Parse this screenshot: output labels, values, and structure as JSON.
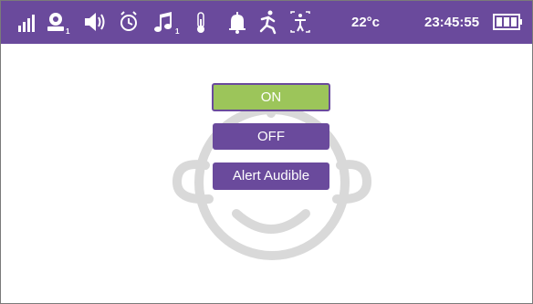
{
  "status_bar": {
    "background": "#6a4a9c",
    "icons": [
      {
        "name": "signal-icon"
      },
      {
        "name": "person-icon",
        "badge": "1"
      },
      {
        "name": "speaker-icon"
      },
      {
        "name": "alarm-clock-icon"
      },
      {
        "name": "music-note-icon",
        "badge": "1"
      },
      {
        "name": "thermometer-icon"
      },
      {
        "name": "bell-icon"
      },
      {
        "name": "running-person-icon"
      },
      {
        "name": "person-frame-icon"
      },
      {
        "name": "battery-icon"
      }
    ],
    "temperature": "22°c",
    "time": "23:45:55"
  },
  "buttons": {
    "on_label": "ON",
    "off_label": "OFF",
    "alert_label": "Alert Audible"
  },
  "colors": {
    "accent": "#6a4a9c",
    "on_green": "#9cc55a",
    "face_gray": "#d9d9d9"
  }
}
